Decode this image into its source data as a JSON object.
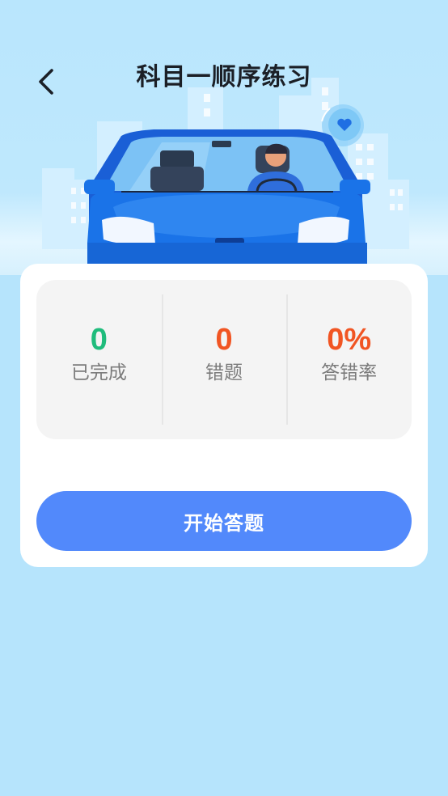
{
  "header": {
    "title": "科目一顺序练习",
    "back_icon": "chevron-left-icon"
  },
  "stats": [
    {
      "value": "0",
      "label": "已完成",
      "color": "#1fbc7c"
    },
    {
      "value": "0",
      "label": "错题",
      "color": "#f15523"
    },
    {
      "value": "0%",
      "label": "答错率",
      "color": "#f15523"
    }
  ],
  "start_button": {
    "label": "开始答题",
    "color": "#5289fb"
  },
  "colors": {
    "background": "#b6e4fc",
    "car": "#1a73e8"
  }
}
